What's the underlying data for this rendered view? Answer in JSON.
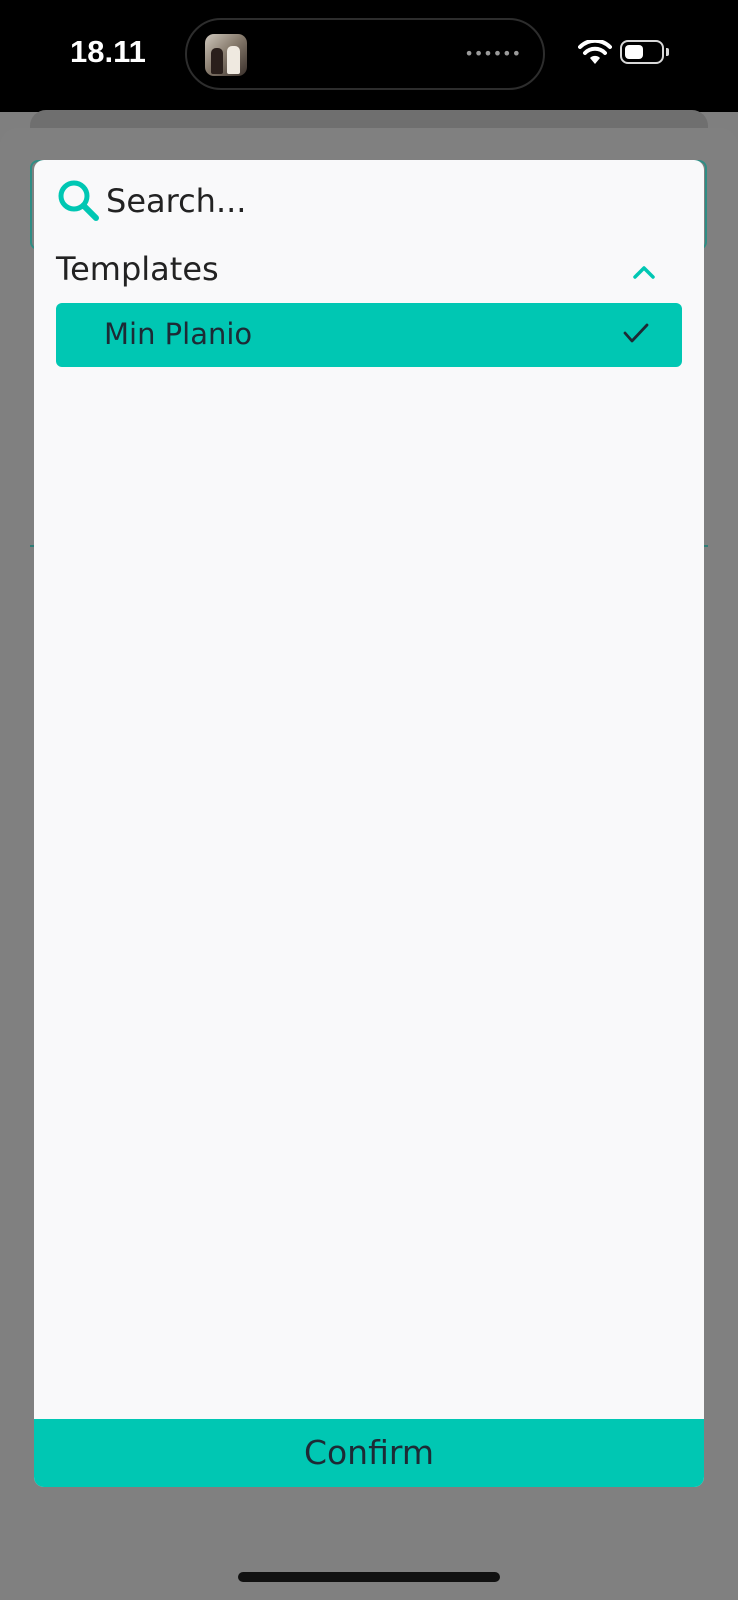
{
  "status_bar": {
    "time": "18.11",
    "live_activity_icon": "photo-thumbnail",
    "wifi_icon": "wifi-icon",
    "battery_icon": "battery-icon"
  },
  "dropdown": {
    "search": {
      "placeholder": "Search...",
      "value": "",
      "icon": "search-icon"
    },
    "section": {
      "title": "Templates",
      "icon": "chevron-up-icon"
    },
    "options": [
      {
        "label": "Min Planio",
        "selected": true,
        "icon": "check-icon"
      }
    ],
    "confirm_label": "Confirm"
  },
  "colors": {
    "accent": "#00c7b3",
    "overlay": "#808080",
    "panel_background": "#f9f9fa",
    "text": "#1d2a35"
  }
}
